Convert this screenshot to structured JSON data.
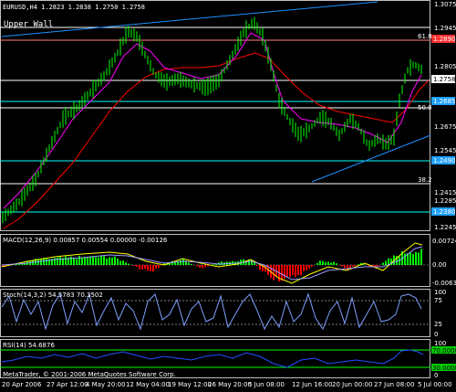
{
  "header": {
    "symbol_info": "EURUSD,H4  1.2823  1.2838  1.2750  1.2758",
    "annotation": "Upper Wall"
  },
  "price_axis": {
    "ticks": [
      "1.3075",
      "1.2945",
      "1.2805",
      "1.2675",
      "1.2545",
      "1.2415",
      "1.2285",
      "1.2245"
    ],
    "tags": [
      {
        "text": "1.2890",
        "color": "#ff3030"
      },
      {
        "text": "1.2758",
        "color": "#ffffff"
      },
      {
        "text": "1.2685",
        "color": "#20a0ff"
      },
      {
        "text": "1.2490",
        "color": "#20a0ff"
      },
      {
        "text": "1.2380",
        "color": "#20a0ff"
      }
    ],
    "fib_labels": [
      "61.8",
      "50.0",
      "38.2"
    ]
  },
  "macd": {
    "label": "MACD(12,26,9) 0.00857 0.00554 0.00000 -0.00126",
    "ticks": [
      "0.00724",
      "0.00",
      "-0.0063"
    ]
  },
  "stoch": {
    "label": "Stoch(14,3,2) 54.5783 70.3502",
    "ticks": [
      "100",
      "75",
      "25",
      "0"
    ]
  },
  "rsi": {
    "label": "RSI(14) 54.6876",
    "ticks": [
      "100",
      "70.0000",
      "30.0000",
      "0"
    ],
    "footer": "MetaTrader, © 2001-2006 MetaQuotes Software Corp."
  },
  "time_axis": {
    "labels": [
      "20 Apr 2006",
      "27 Apr 12:00",
      "4 May 20:00",
      "12 May 04:00",
      "19 May 12:00",
      "26 May 20:00",
      "5 Jun 08:00",
      "12 Jun 16:00",
      "20 Jun 00:00",
      "27 Jun 08:00",
      "5 Jul 00:00"
    ]
  },
  "colors": {
    "candles": "#00ff00",
    "ma_fast": "#ff00ff",
    "ma_slow": "#ff0000",
    "trend": "#1e90ff",
    "level": "#00ffff",
    "hline": "#ffffff",
    "macd_pos": "#00ff00",
    "macd_neg": "#ff0000",
    "macd_line": "#ffff00",
    "macd_signal": "#9999ff",
    "stoch": "#7f9fff",
    "rsi": "#2050ff"
  }
}
